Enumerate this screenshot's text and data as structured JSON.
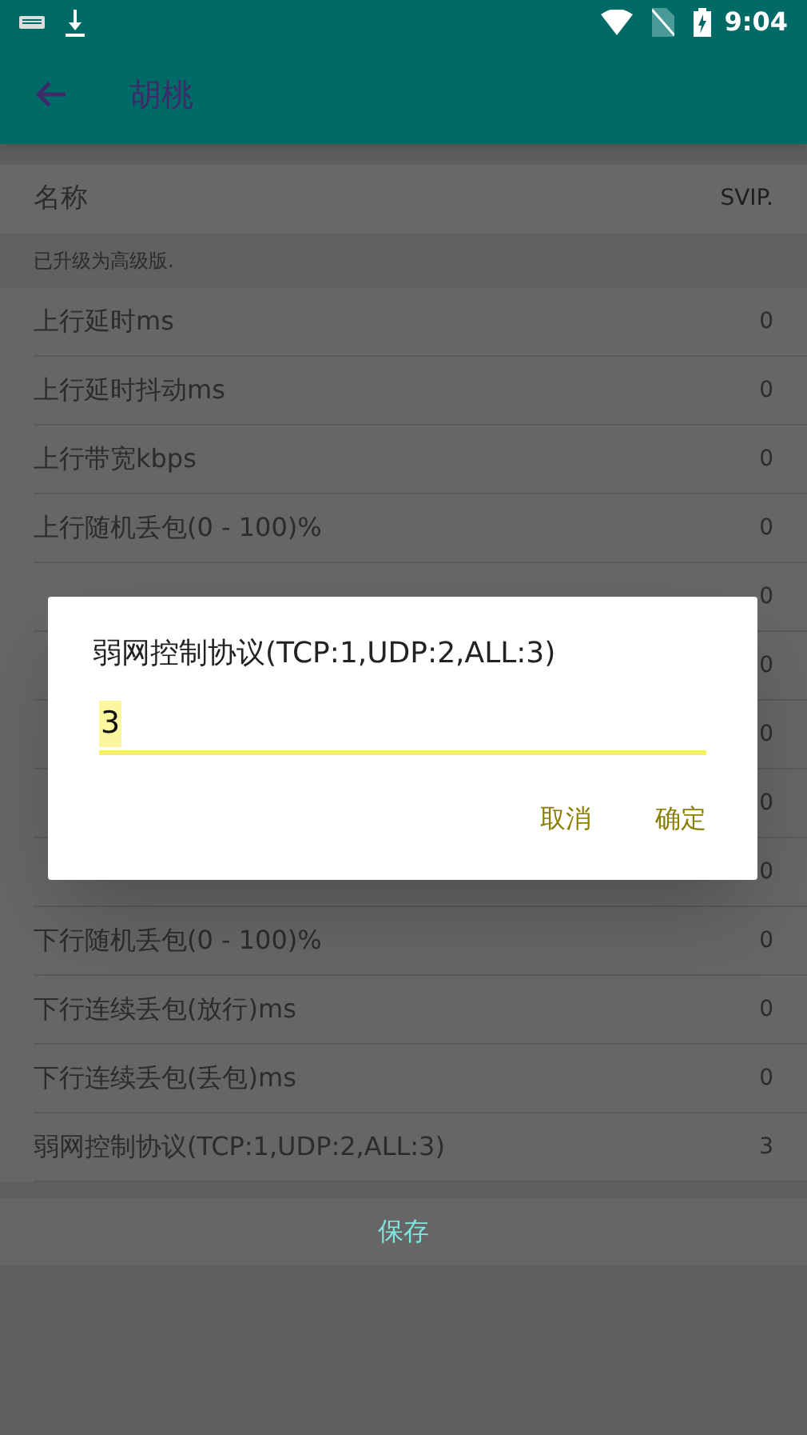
{
  "status_bar": {
    "time": "9:04"
  },
  "app_bar": {
    "title": "胡桃"
  },
  "name_row": {
    "label": "名称",
    "value": "SVIP."
  },
  "notice": "已升级为高级版.",
  "rows": [
    {
      "label": "上行延时ms",
      "value": "0"
    },
    {
      "label": "上行延时抖动ms",
      "value": "0"
    },
    {
      "label": "上行带宽kbps",
      "value": "0"
    },
    {
      "label": "上行随机丢包(0 - 100)%",
      "value": "0"
    },
    {
      "value": "0"
    },
    {
      "value": "0"
    },
    {
      "value": "0"
    },
    {
      "value": "0"
    },
    {
      "value": "0"
    },
    {
      "label": "下行随机丢包(0 - 100)%",
      "value": "0"
    },
    {
      "label": "下行连续丢包(放行)ms",
      "value": "0"
    },
    {
      "label": "下行连续丢包(丢包)ms",
      "value": "0"
    },
    {
      "label": "弱网控制协议(TCP:1,UDP:2,ALL:3)",
      "value": "3"
    }
  ],
  "save_button": "保存",
  "dialog": {
    "title": "弱网控制协议(TCP:1,UDP:2,ALL:3)",
    "value": "3",
    "buttons": [
      "取消",
      "确定"
    ]
  }
}
